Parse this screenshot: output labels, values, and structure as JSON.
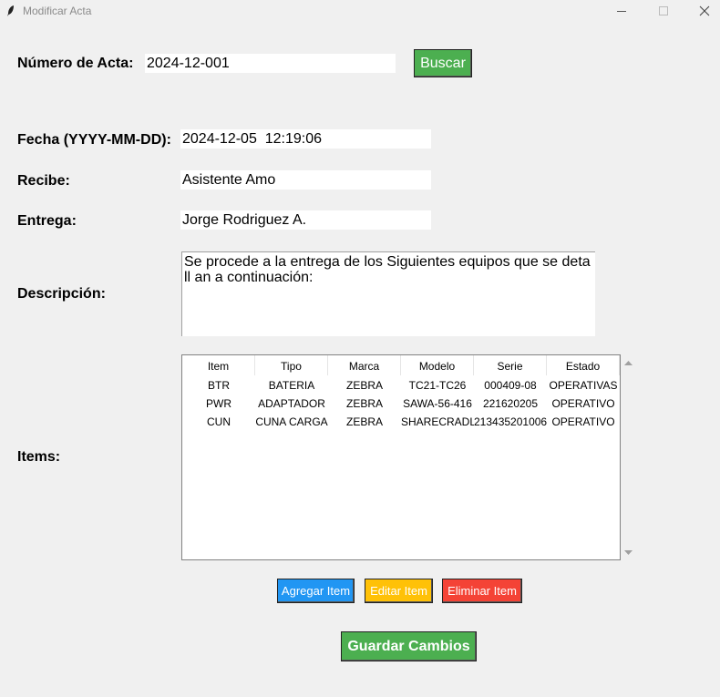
{
  "window": {
    "title": "Modificar Acta"
  },
  "search": {
    "label": "Número de Acta:",
    "value": "2024-12-001",
    "button": "Buscar"
  },
  "form": {
    "fecha_label": "Fecha (YYYY-MM-DD):",
    "fecha_value": "2024-12-05  12:19:06",
    "recibe_label": "Recibe:",
    "recibe_value": "Asistente Amo",
    "entrega_label": "Entrega:",
    "entrega_value": "Jorge Rodriguez A.",
    "descripcion_label": "Descripción:",
    "descripcion_value": "Se procede a la entrega de los Siguientes equipos que se detall an a continuación:",
    "items_label": "Items:"
  },
  "items_table": {
    "columns": [
      "Item",
      "Tipo",
      "Marca",
      "Modelo",
      "Serie",
      "Estado"
    ],
    "rows": [
      [
        "BTR",
        "BATERIA",
        "ZEBRA",
        "TC21-TC26",
        "000409-08",
        "OPERATIVAS"
      ],
      [
        "PWR",
        "ADAPTADOR",
        "ZEBRA",
        "SAWA-56-416",
        "221620205",
        "OPERATIVO"
      ],
      [
        "CUN",
        "CUNA CARGA",
        "ZEBRA",
        "SHARECRADLE",
        "213435201006",
        "OPERATIVO"
      ]
    ]
  },
  "actions": {
    "add": "Agregar Item",
    "edit": "Editar Item",
    "delete": "Eliminar Item",
    "save": "Guardar Cambios"
  },
  "colors": {
    "green": "#4caf50",
    "blue": "#2196f3",
    "yellow": "#ffc107",
    "red": "#f44336",
    "background": "#f0f0f0"
  },
  "icons": {
    "app": "feather-icon",
    "minimize": "minimize-icon",
    "maximize": "maximize-icon",
    "close": "close-icon"
  }
}
